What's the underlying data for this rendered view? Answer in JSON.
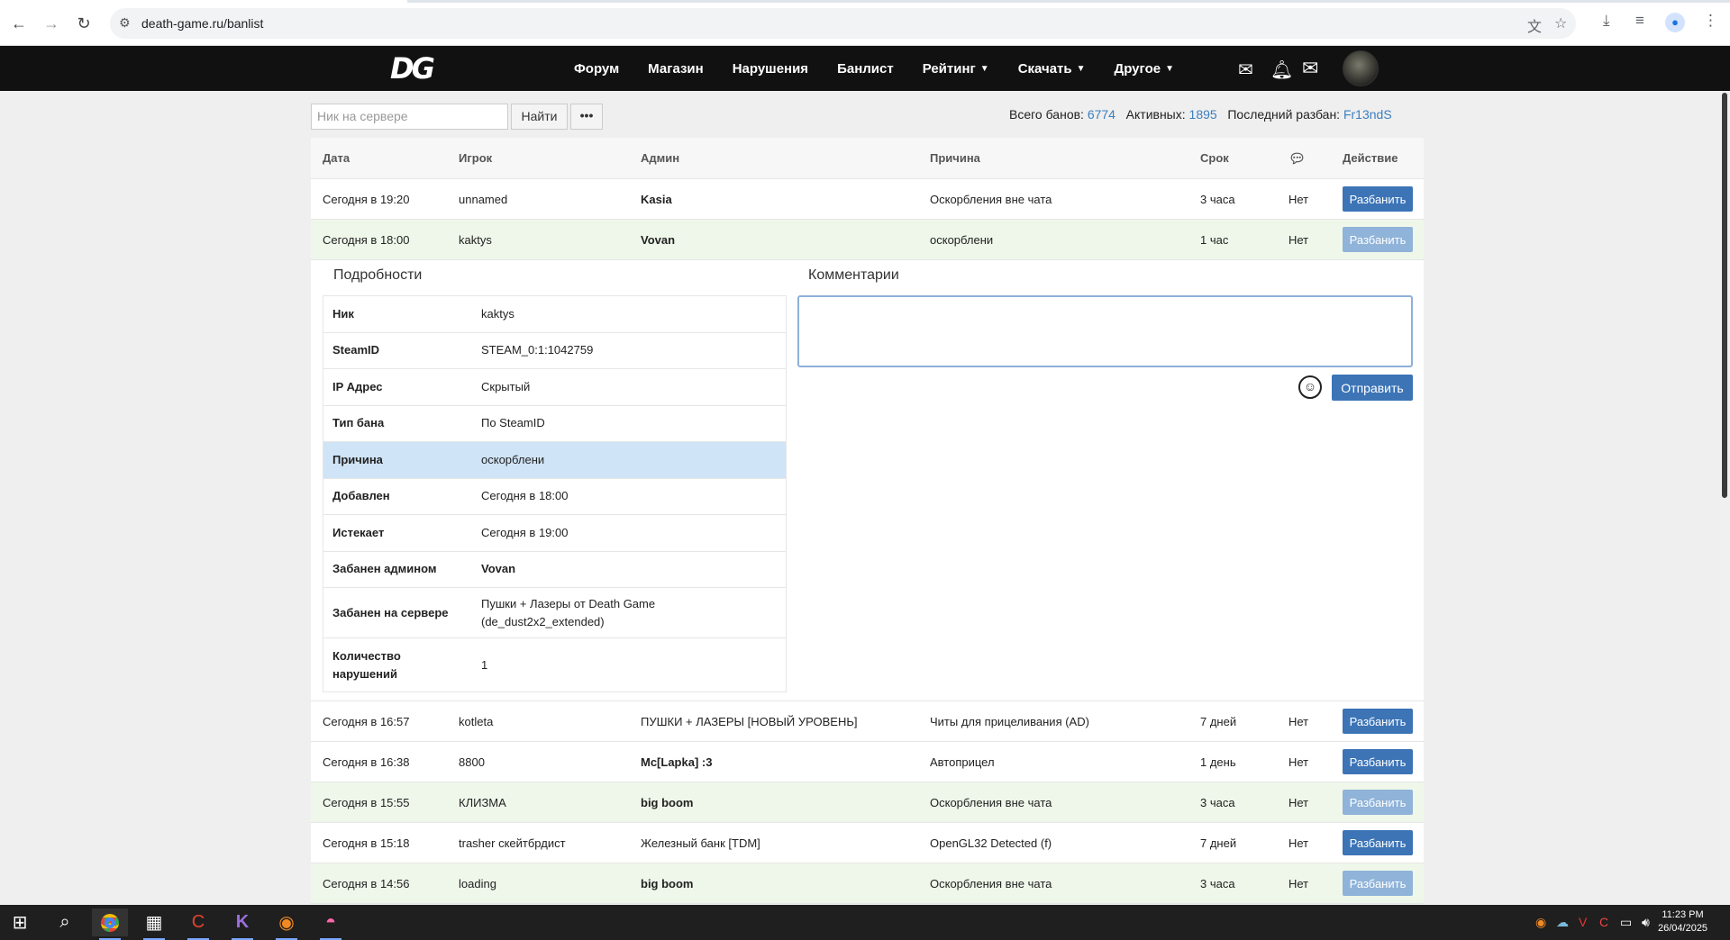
{
  "browser": {
    "url": "death-game.ru/banlist"
  },
  "site": {
    "logo_text": "DG",
    "menu": [
      {
        "label": "Форум",
        "dropdown": false
      },
      {
        "label": "Магазин",
        "dropdown": false
      },
      {
        "label": "Нарушения",
        "dropdown": false
      },
      {
        "label": "Банлист",
        "dropdown": false
      },
      {
        "label": "Рейтинг",
        "dropdown": true
      },
      {
        "label": "Скачать",
        "dropdown": true
      },
      {
        "label": "Другое",
        "dropdown": true
      }
    ]
  },
  "toolbar": {
    "search_placeholder": "Ник на сервере",
    "find_label": "Найти",
    "more_label": "•••"
  },
  "stats": {
    "total_label": "Всего банов:",
    "total_value": "6774",
    "active_label": "Активных:",
    "active_value": "1895",
    "last_unban_label": "Последний разбан:",
    "last_unban_value": "Fr13ndS"
  },
  "table": {
    "headers": {
      "date": "Дата",
      "player": "Игрок",
      "admin": "Админ",
      "reason": "Причина",
      "term": "Срок",
      "action": "Действие"
    },
    "unban_label": "Разбанить",
    "rows_top": [
      {
        "date": "Сегодня в 19:20",
        "player": "unnamed",
        "admin": "Kasia",
        "reason": "Оскорбления вне чата",
        "term": "3 часа",
        "comments": "Нет"
      },
      {
        "date": "Сегодня в 18:00",
        "player": "kaktys",
        "admin": "Vovan",
        "reason": "оскорблени",
        "term": "1 час",
        "comments": "Нет"
      }
    ],
    "rows_bottom": [
      {
        "date": "Сегодня в 16:57",
        "player": "kotleta",
        "admin": "ПУШКИ + ЛАЗЕРЫ [НОВЫЙ УРОВЕНЬ]",
        "reason": "Читы для прицеливания (AD)",
        "term": "7 дней",
        "comments": "Нет"
      },
      {
        "date": "Сегодня в 16:38",
        "player": "8800",
        "admin": "Mc[Lapka] :3",
        "reason": "Автоприцел",
        "term": "1 день",
        "comments": "Нет"
      },
      {
        "date": "Сегодня в 15:55",
        "player": "КЛИЗМА",
        "admin": "big boom",
        "reason": "Оскорбления вне чата",
        "term": "3 часа",
        "comments": "Нет"
      },
      {
        "date": "Сегодня в 15:18",
        "player": "trasher скейтбрдист",
        "admin": "Железный банк [TDM]",
        "reason": "OpenGL32 Detected (f)",
        "term": "7 дней",
        "comments": "Нет"
      },
      {
        "date": "Сегодня в 14:56",
        "player": "loading",
        "admin": "big boom",
        "reason": "Оскорбления вне чата",
        "term": "3 часа",
        "comments": "Нет"
      }
    ]
  },
  "details": {
    "title": "Подробности",
    "rows": [
      {
        "label": "Ник",
        "value": "kaktys"
      },
      {
        "label": "SteamID",
        "value": "STEAM_0:1:1042759"
      },
      {
        "label": "IP Адрес",
        "value": "Скрытый"
      },
      {
        "label": "Тип бана",
        "value": "По SteamID"
      },
      {
        "label": "Причина",
        "value": "оскорблени"
      },
      {
        "label": "Добавлен",
        "value": "Сегодня в 18:00"
      },
      {
        "label": "Истекает",
        "value": "Сегодня в 19:00"
      },
      {
        "label": "Забанен админом",
        "value": "Vovan"
      },
      {
        "label": "Забанен на сервере",
        "value": "Пушки + Лазеры от Death Game (de_dust2x2_extended)"
      },
      {
        "label": "Количество нарушений",
        "value": "1"
      }
    ]
  },
  "comments": {
    "title": "Комментарии",
    "send_label": "Отправить",
    "textarea_value": ""
  },
  "taskbar": {
    "time": "11:23 PM",
    "date": "26/04/2025"
  },
  "colors": {
    "accent": "#3c74b6",
    "header_bg": "#111111",
    "row_alt": "#eef7ea",
    "highlight": "#cfe4f6"
  }
}
